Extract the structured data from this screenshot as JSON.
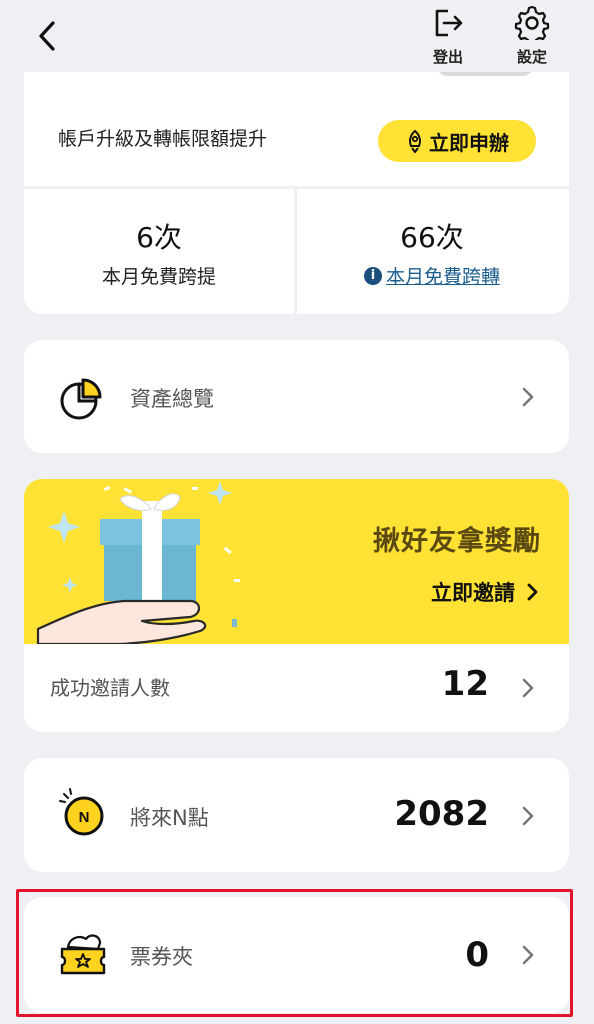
{
  "header": {
    "back_icon": "chevron-left-icon",
    "logout_label": "登出",
    "logout_icon": "logout-icon",
    "settings_label": "設定",
    "settings_icon": "gear-icon"
  },
  "upgrade": {
    "text": "帳戶升級及轉帳限額提升",
    "button_label": "立即申辦",
    "button_icon": "rocket-icon",
    "accent_color": "#ffe234"
  },
  "quotas": [
    {
      "value": "6次",
      "label": "本月免費跨提"
    },
    {
      "value": "66次",
      "label": "本月免費跨轉",
      "info_icon": "info-icon"
    }
  ],
  "asset_overview": {
    "label": "資產總覽",
    "icon": "pie-chart-icon"
  },
  "invite": {
    "banner_title": "揪好友拿獎勵",
    "banner_cta": "立即邀請",
    "count_label": "成功邀請人數",
    "count": "12",
    "banner_icon": "gift-in-hand-icon"
  },
  "points": {
    "label": "將來N點",
    "value": "2082",
    "icon": "n-coin-icon"
  },
  "tickets": {
    "label": "票券夾",
    "value": "0",
    "icon": "ticket-icon"
  },
  "colors": {
    "highlight": "#e3132c",
    "link": "#1b5d8f",
    "background": "#eef0f3"
  }
}
